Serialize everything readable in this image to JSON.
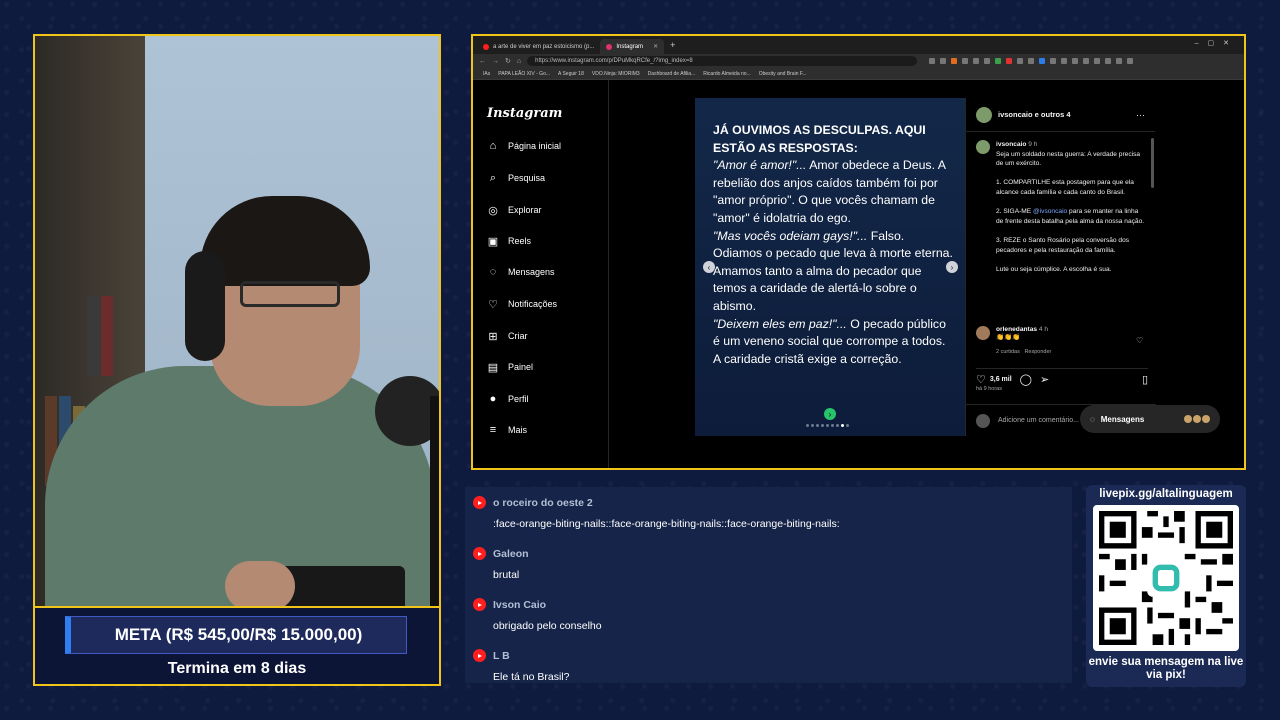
{
  "meta": {
    "goal": "META (R$ 545,00/R$ 15.000,00)",
    "ends": "Termina em 8 dias"
  },
  "browser": {
    "tabs": [
      {
        "label": "a arte de viver em paz estoicismo (p..."
      },
      {
        "label": "Instagram"
      }
    ],
    "url": "https://www.instagram.com/p/DPuMkqRCfe_/?img_index=8",
    "bookmarks": [
      "IAs",
      "PAPA LEÃO XIV - Go...",
      "A Seguir 18",
      "VDO.Ninja: MIORIM3",
      "Dashboard de Afilia...",
      "Ricardo Almeida no...",
      "Obesity and Brain F..."
    ]
  },
  "instagram": {
    "logo": "Instagram",
    "nav": [
      {
        "label": "Página inicial",
        "icon": "home-icon",
        "glyph": "⌂"
      },
      {
        "label": "Pesquisa",
        "icon": "search-icon",
        "glyph": "⌕"
      },
      {
        "label": "Explorar",
        "icon": "compass-icon",
        "glyph": "◎"
      },
      {
        "label": "Reels",
        "icon": "reels-icon",
        "glyph": "▣"
      },
      {
        "label": "Mensagens",
        "icon": "messenger-icon",
        "glyph": "◌"
      },
      {
        "label": "Notificações",
        "icon": "heart-icon",
        "glyph": "♡"
      },
      {
        "label": "Criar",
        "icon": "plus-icon",
        "glyph": "⊞"
      },
      {
        "label": "Painel",
        "icon": "dashboard-icon",
        "glyph": "▤"
      },
      {
        "label": "Perfil",
        "icon": "profile-icon",
        "glyph": "●"
      },
      {
        "label": "Mais",
        "icon": "menu-icon",
        "glyph": "≡"
      }
    ],
    "slide": {
      "heading": "JÁ OUVIMOS AS DESCULPAS. AQUI ESTÃO AS RESPOSTAS:",
      "q1": "\"Amor é amor!\"...",
      "a1": " Amor obedece a Deus. A rebelião dos anjos caídos também foi por \"amor próprio\". O que vocês chamam de \"amor\" é idolatria do ego.",
      "q2": "\"Mas vocês odeiam gays!\"...",
      "a2": " Falso. Odiamos o pecado que leva à morte eterna. Amamos tanto a alma do pecador que temos a caridade de alertá-lo sobre o abismo.",
      "q3": "\"Deixem eles em paz!\"...",
      "a3": " O pecado público é um veneno social que corrompe a todos. A caridade cristã exige a correção."
    },
    "post_header": "ivsoncaio e outros 4",
    "caption": {
      "user": "ivsoncaio",
      "time": "9 h",
      "p1": "Seja um soldado nesta guerra: A verdade precisa de um exército.",
      "p2": "1. COMPARTILHE esta postagem para que ela alcance cada família e cada canto do Brasil.",
      "p3a": "2. SIGA-ME ",
      "p3m": "@ivsoncaio",
      "p3b": " para se manter na linha de frente desta batalha pela alma da nossa nação.",
      "p4": "3. REZE o Santo Rosário pela conversão dos pecadores e pela restauração da família.",
      "p5": "Lute ou seja cúmplice. A escolha é sua."
    },
    "comment": {
      "user": "orlenedantas",
      "time": "4 h",
      "text": "👏👏👏",
      "likes": "2 curtidas",
      "reply": "Responder"
    },
    "likes": "3,6 mil",
    "ago": "há 9 horas",
    "add_comment_placeholder": "Adicione um comentário...",
    "messages_label": "Mensagens"
  },
  "chat": [
    {
      "name": "o roceiro do oeste 2",
      "text": ":face-orange-biting-nails::face-orange-biting-nails::face-orange-biting-nails:"
    },
    {
      "name": "Galeon",
      "text": "brutal"
    },
    {
      "name": "Ivson Caio",
      "text": "obrigado pelo conselho"
    },
    {
      "name": "L B",
      "text": "Ele tá no Brasil?"
    }
  ],
  "qr": {
    "title": "livepix.gg/altalinguagem",
    "footer": "envie sua mensagem na live via pix!"
  },
  "colors": {
    "frame": "#f0c419",
    "background": "#0f1a3f",
    "youtube": "#ff1f1f"
  }
}
